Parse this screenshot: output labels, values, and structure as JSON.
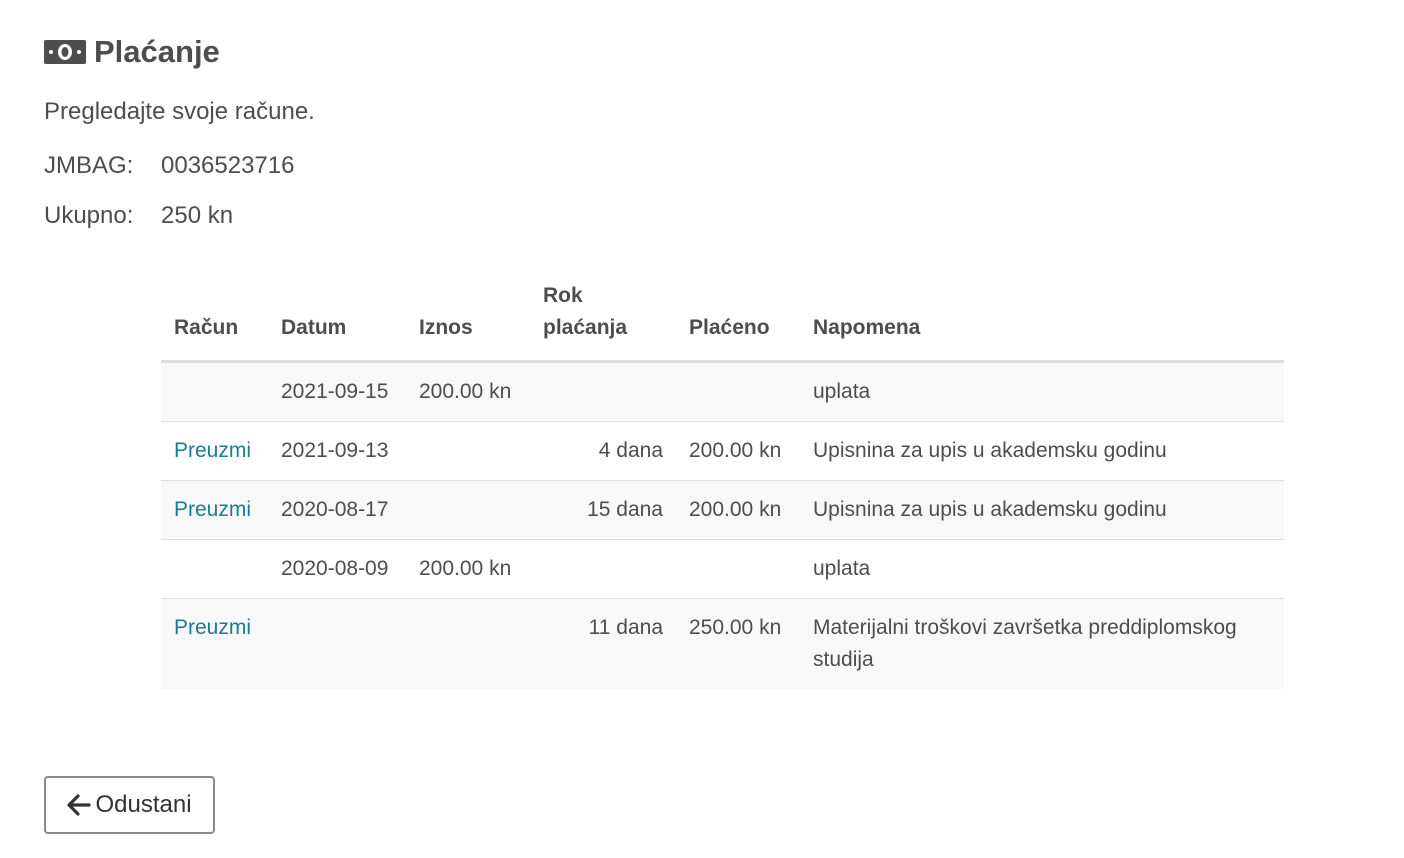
{
  "header": {
    "title": "Plaćanje",
    "icon": "money-bill-icon",
    "subtitle": "Pregledajte svoje račune."
  },
  "info": {
    "jmbag_label": "JMBAG:",
    "jmbag_value": "0036523716",
    "total_label": "Ukupno:",
    "total_value": "250 kn"
  },
  "table": {
    "headers": {
      "racun": "Račun",
      "datum": "Datum",
      "iznos": "Iznos",
      "rok_line1": "Rok",
      "rok_line2": "plaćanja",
      "placeno": "Plaćeno",
      "napomena": "Napomena"
    },
    "rows": [
      {
        "racun": "",
        "datum": "2021-09-15",
        "iznos": "200.00 kn",
        "rok": "",
        "placeno": "",
        "napomena": "uplata"
      },
      {
        "racun": "Preuzmi",
        "datum": "2021-09-13",
        "iznos": "",
        "rok": "4 dana",
        "placeno": "200.00 kn",
        "napomena": "Upisnina za upis u akademsku godinu"
      },
      {
        "racun": "Preuzmi",
        "datum": "2020-08-17",
        "iznos": "",
        "rok": "15 dana",
        "placeno": "200.00 kn",
        "napomena": "Upisnina za upis u akademsku godinu"
      },
      {
        "racun": "",
        "datum": "2020-08-09",
        "iznos": "200.00 kn",
        "rok": "",
        "placeno": "",
        "napomena": "uplata"
      },
      {
        "racun": "Preuzmi",
        "datum": "",
        "iznos": "",
        "rok": "11 dana",
        "placeno": "250.00 kn",
        "napomena": "Materijalni troškovi završetka preddiplomskog studija"
      }
    ]
  },
  "actions": {
    "cancel_label": "Odustani",
    "cancel_icon": "arrow-left-icon"
  },
  "colors": {
    "text": "#4d4d4d",
    "link": "#1a7c92",
    "row_stripe": "#f8f8f8",
    "border": "#dedede"
  }
}
